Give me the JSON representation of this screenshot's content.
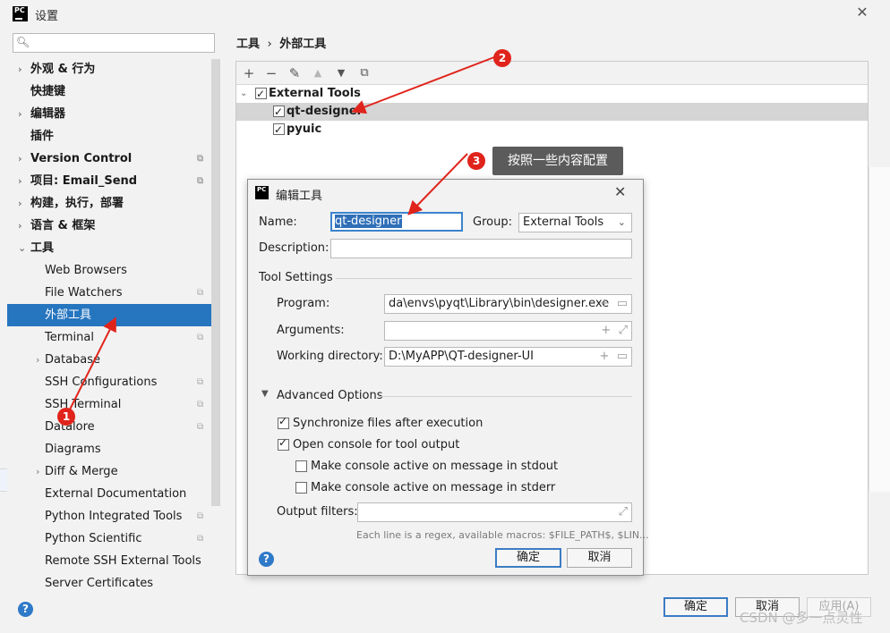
{
  "window": {
    "title": "设置",
    "logo": "PC"
  },
  "search": {
    "placeholder": ""
  },
  "sidebar": {
    "items": [
      {
        "label": "外观 & 行为",
        "arrow": "›",
        "level": 0
      },
      {
        "label": "快捷键",
        "arrow": "",
        "level": 0
      },
      {
        "label": "编辑器",
        "arrow": "›",
        "level": 0
      },
      {
        "label": "插件",
        "arrow": "",
        "level": 0
      },
      {
        "label": "Version Control",
        "arrow": "›",
        "level": 0
      },
      {
        "label": "项目: Email_Send",
        "arrow": "›",
        "level": 0
      },
      {
        "label": "构建，执行，部署",
        "arrow": "›",
        "level": 0
      },
      {
        "label": "语言 & 框架",
        "arrow": "›",
        "level": 0
      },
      {
        "label": "工具",
        "arrow": "⌄",
        "level": 0
      },
      {
        "label": "Web Browsers",
        "arrow": "",
        "level": 1
      },
      {
        "label": "File Watchers",
        "arrow": "",
        "level": 1
      },
      {
        "label": "外部工具",
        "arrow": "",
        "level": 1
      },
      {
        "label": "Terminal",
        "arrow": "",
        "level": 1
      },
      {
        "label": "Database",
        "arrow": "›",
        "level": 1
      },
      {
        "label": "SSH Configurations",
        "arrow": "",
        "level": 1
      },
      {
        "label": "SSH Terminal",
        "arrow": "",
        "level": 1
      },
      {
        "label": "Datalore",
        "arrow": "",
        "level": 1
      },
      {
        "label": "Diagrams",
        "arrow": "",
        "level": 1
      },
      {
        "label": "Diff & Merge",
        "arrow": "›",
        "level": 1
      },
      {
        "label": "External Documentation",
        "arrow": "",
        "level": 1
      },
      {
        "label": "Python Integrated Tools",
        "arrow": "",
        "level": 1
      },
      {
        "label": "Python Scientific",
        "arrow": "",
        "level": 1
      },
      {
        "label": "Remote SSH External Tools",
        "arrow": "",
        "level": 1
      },
      {
        "label": "Server Certificates",
        "arrow": "",
        "level": 1
      }
    ],
    "selected": "外部工具"
  },
  "breadcrumb": {
    "part1": "工具",
    "sep": "›",
    "part2": "外部工具"
  },
  "toolbar": {
    "add": "+",
    "remove": "−",
    "edit": "✎",
    "up": "▲",
    "down": "▼",
    "copy": "⧉"
  },
  "tools_tree": {
    "group": "External Tools",
    "items": [
      "qt-designer",
      "pyuic"
    ]
  },
  "dialog": {
    "title": "编辑工具",
    "logo": "PC",
    "name_label": "Name:",
    "name_value": "qt-designer",
    "group_label": "Group:",
    "group_value": "External Tools",
    "description_label": "Description:",
    "description_value": "",
    "tool_settings": "Tool Settings",
    "program_label": "Program:",
    "program_value": "da\\envs\\pyqt\\Library\\bin\\designer.exe",
    "arguments_label": "Arguments:",
    "arguments_value": "",
    "workdir_label": "Working directory:",
    "workdir_value": "D:\\MyAPP\\QT-designer-UI",
    "advanced": "Advanced Options",
    "opt_sync": "Synchronize files after execution",
    "opt_console": "Open console for tool output",
    "opt_stdout": "Make console active on message in stdout",
    "opt_stderr": "Make console active on message in stderr",
    "output_filters_label": "Output filters:",
    "hint": "Each line is a regex, available macros: $FILE_PATH$, $LIN...",
    "ok": "确定",
    "cancel": "取消"
  },
  "footer": {
    "ok": "确定",
    "cancel": "取消",
    "apply": "应用(A)"
  },
  "annotations": {
    "badge1": "1",
    "badge2": "2",
    "badge3": "3",
    "callout": "按照一些内容配置",
    "color": "#e0241c"
  },
  "watermark": "CSDN @多一点灵性"
}
